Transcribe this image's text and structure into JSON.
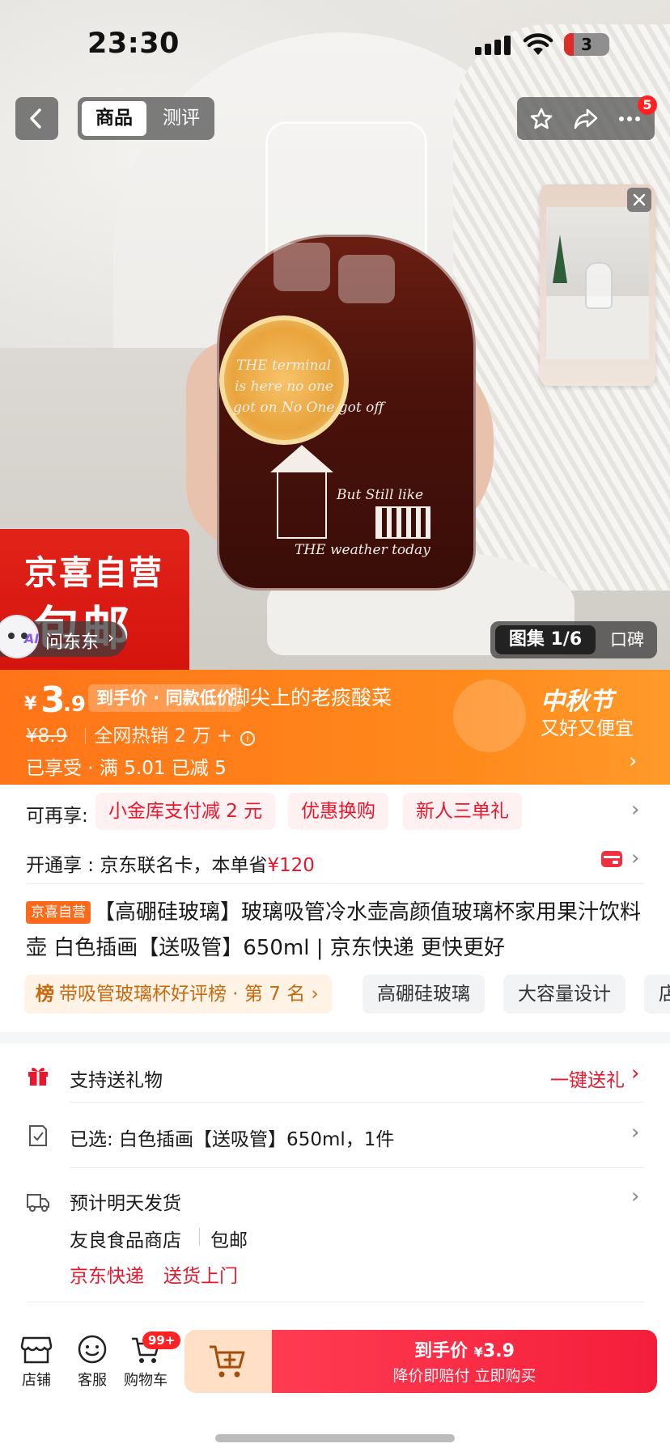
{
  "status_bar": {
    "time": "23:30",
    "battery": "3"
  },
  "top_nav": {
    "tab_product": "商品",
    "tab_review": "测评",
    "more_badge": "5"
  },
  "hero": {
    "jar_text_1": "THE terminal",
    "jar_text_2": "is here no one",
    "jar_text_3": "got on  No One got off",
    "jar_text_4": "But Still like",
    "jar_text_5": "THE weather today",
    "sticker_line1": "京喜自营",
    "sticker_line2": "包邮",
    "ask_ai": "AI",
    "ask_label": "问东东",
    "gallery_label": "图集 1/6",
    "review_label": "口碑"
  },
  "price_banner": {
    "currency": "¥",
    "price_int": "3",
    "price_dec": ".9",
    "tag": "到手价 · 同款低价",
    "ticker": "脚尖上的老痰酸菜",
    "original_price": "¥8.9",
    "sales": "全网热销 2 万 +",
    "enjoyed": "已享受 · 满 5.01 已减 5",
    "festival_title": "中秋节",
    "festival_sub": "又好又便宜"
  },
  "benefits": {
    "more_label": "可再享:",
    "chips": [
      "小金库支付减 2 元",
      "优惠换购",
      "新人三单礼"
    ],
    "card_label": "开通享 : 京东联名卡，本单省",
    "card_amount": "¥120"
  },
  "title": {
    "badge": "京喜自营",
    "text": "【高硼硅玻璃】玻璃吸管冷水壶高颜值玻璃杯家用果汁饮料壶 白色插画【送吸管】650ml | 京东快递 更快更好"
  },
  "tags": {
    "rank_icon": "榜",
    "rank_text": "带吸管玻璃杯好评榜 · 第 7 名",
    "features": [
      "高硼硅玻璃",
      "大容量设计",
      "店"
    ]
  },
  "services": {
    "gift_label": "支持送礼物",
    "gift_action": "一键送礼",
    "selected_label": "已选:  白色插画【送吸管】650ml，1件",
    "ship_label": "预计明天发货",
    "shop_name": "友良食品商店",
    "free_ship": "包邮",
    "express": "京东快递",
    "door": "送货上门"
  },
  "bottom_bar": {
    "shop": "店铺",
    "service": "客服",
    "cart": "购物车",
    "cart_badge": "99+",
    "buy_line1_prefix": "到手价",
    "buy_currency": "¥",
    "buy_price": "3.9",
    "buy_line2": "降价即赔付 立即购买"
  },
  "colors": {
    "accent_red": "#e8172d",
    "banner_orange": "#ff7a1a",
    "jx_orange": "#ff6a1a"
  }
}
